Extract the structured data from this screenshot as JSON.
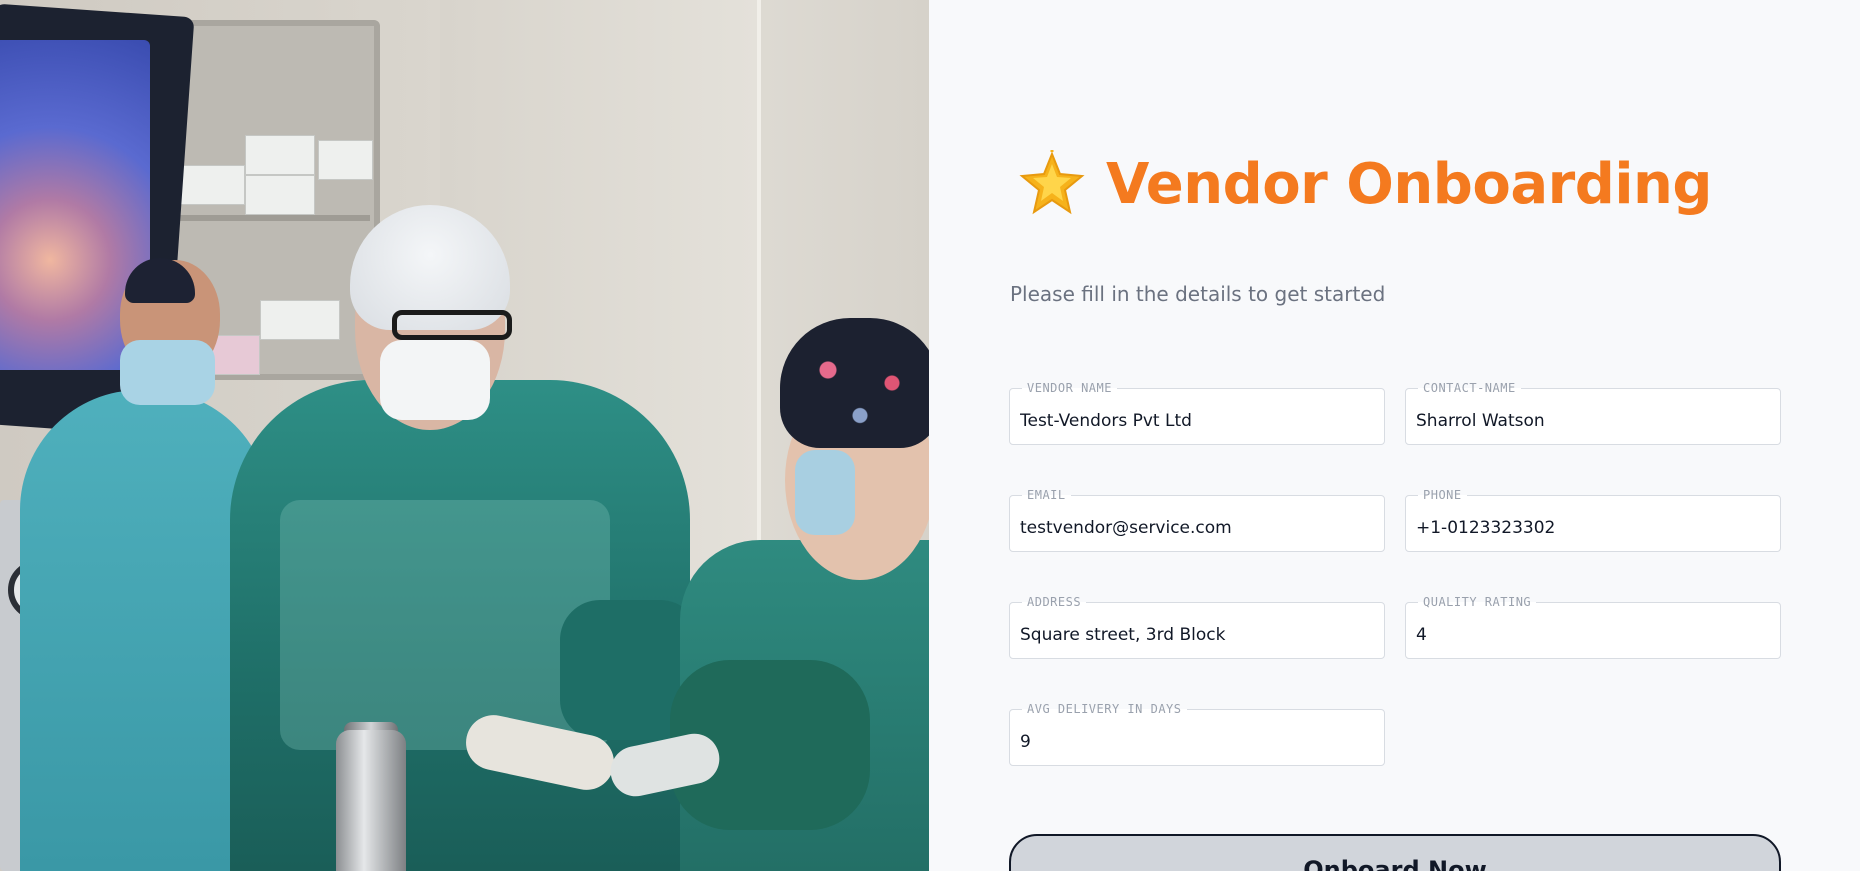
{
  "page": {
    "title_icon": "glowing-star-icon",
    "title": "Vendor Onboarding",
    "subtitle": "Please fill in the details to get started"
  },
  "form": {
    "fields": [
      {
        "key": "vendor_name",
        "label": "VENDOR NAME",
        "value": "Test-Vendors Pvt Ltd"
      },
      {
        "key": "contact_name",
        "label": "CONTACT-NAME",
        "value": "Sharrol Watson"
      },
      {
        "key": "email",
        "label": "EMAIL",
        "value": "testvendor@service.com"
      },
      {
        "key": "phone",
        "label": "PHONE",
        "value": "+1-0123323302"
      },
      {
        "key": "address",
        "label": "ADDRESS",
        "value": "Square street, 3rd Block"
      },
      {
        "key": "quality_rating",
        "label": "QUALITY RATING",
        "value": "4"
      },
      {
        "key": "avg_delivery_days",
        "label": "AVG DELIVERY IN DAYS",
        "value": "9"
      }
    ],
    "submit_label": "Onboard Now"
  },
  "colors": {
    "accent": "#f47a1f",
    "subtitle": "#6b7280",
    "label": "#9aa1ad",
    "button_bg": "#d1d5db"
  },
  "hero_image": {
    "icon": "hero-photo"
  }
}
